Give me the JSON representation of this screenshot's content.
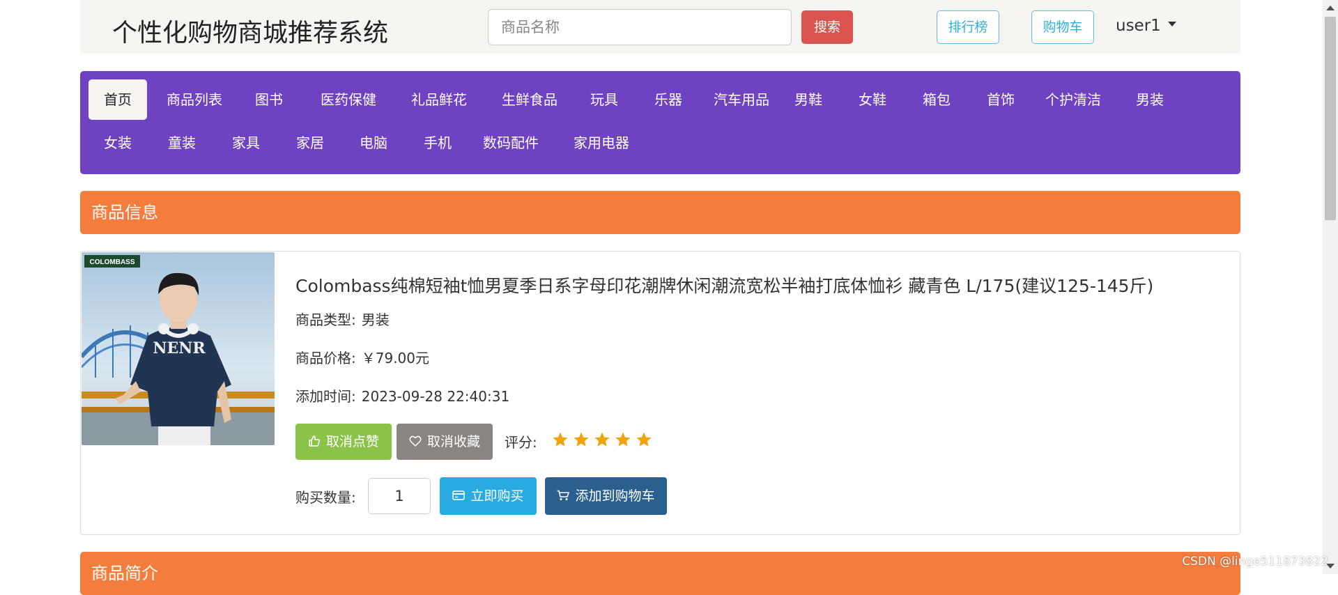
{
  "header": {
    "site_title": "个性化购物商城推荐系统",
    "search_placeholder": "商品名称",
    "search_button": "搜索",
    "ranking_button": "排行榜",
    "cart_button": "购物车",
    "username": "user1"
  },
  "nav": {
    "items": [
      {
        "label": "首页",
        "active": true
      },
      {
        "label": "商品列表"
      },
      {
        "label": "图书"
      },
      {
        "label": "医药保健"
      },
      {
        "label": "礼品鲜花"
      },
      {
        "label": "生鲜食品"
      },
      {
        "label": "玩具"
      },
      {
        "label": "乐器"
      },
      {
        "label": "汽车用品"
      },
      {
        "label": "男鞋"
      },
      {
        "label": "女鞋"
      },
      {
        "label": "箱包"
      },
      {
        "label": "首饰"
      },
      {
        "label": "个护清洁"
      },
      {
        "label": "男装"
      },
      {
        "label": "女装"
      },
      {
        "label": "童装"
      },
      {
        "label": "家具"
      },
      {
        "label": "家居"
      },
      {
        "label": "电脑"
      },
      {
        "label": "手机"
      },
      {
        "label": "数码配件"
      },
      {
        "label": "家用电器"
      }
    ]
  },
  "product_section": {
    "title": "商品信息"
  },
  "product": {
    "name": "Colombass纯棉短袖t恤男夏季日系字母印花潮牌休闲潮流宽松半袖打底体恤衫 藏青色 L/175(建议125-145斤)",
    "image_brand_text": "COLOMBASS",
    "image_shirt_text": "NENR",
    "type_label": "商品类型:",
    "type_value": "男装",
    "price_label": "商品价格:",
    "price_value": "￥79.00元",
    "time_label": "添加时间:",
    "time_value": "2023-09-28 22:40:31",
    "unlike_button": "取消点赞",
    "unfavorite_button": "取消收藏",
    "rating_label": "评分:",
    "rating": 5,
    "rating_max": 5,
    "quantity_label": "购买数量:",
    "quantity_value": "1",
    "buy_now_button": "立即购买",
    "add_cart_button": "添加到购物车"
  },
  "intro_section": {
    "title": "商品简介"
  },
  "watermark": "CSDN @linge511873822",
  "colors": {
    "header_bg": "#f7f5f2",
    "nav_bg": "#6f42c1",
    "section_bg": "#f47d3d",
    "search_btn": "#d9534f",
    "outline_btn": "#5bc0de",
    "unlike_btn": "#8bc34a",
    "unfavorite_btn": "#8a8580",
    "buy_now_btn": "#29abe2",
    "add_cart_btn": "#2b5f8e",
    "star": "#f0a30a"
  },
  "icons": {
    "unlike": "thumbs-up-icon",
    "unfavorite": "heart-icon",
    "buy_now": "credit-card-icon",
    "add_cart": "shopping-cart-icon",
    "user_menu": "caret-down-icon"
  }
}
